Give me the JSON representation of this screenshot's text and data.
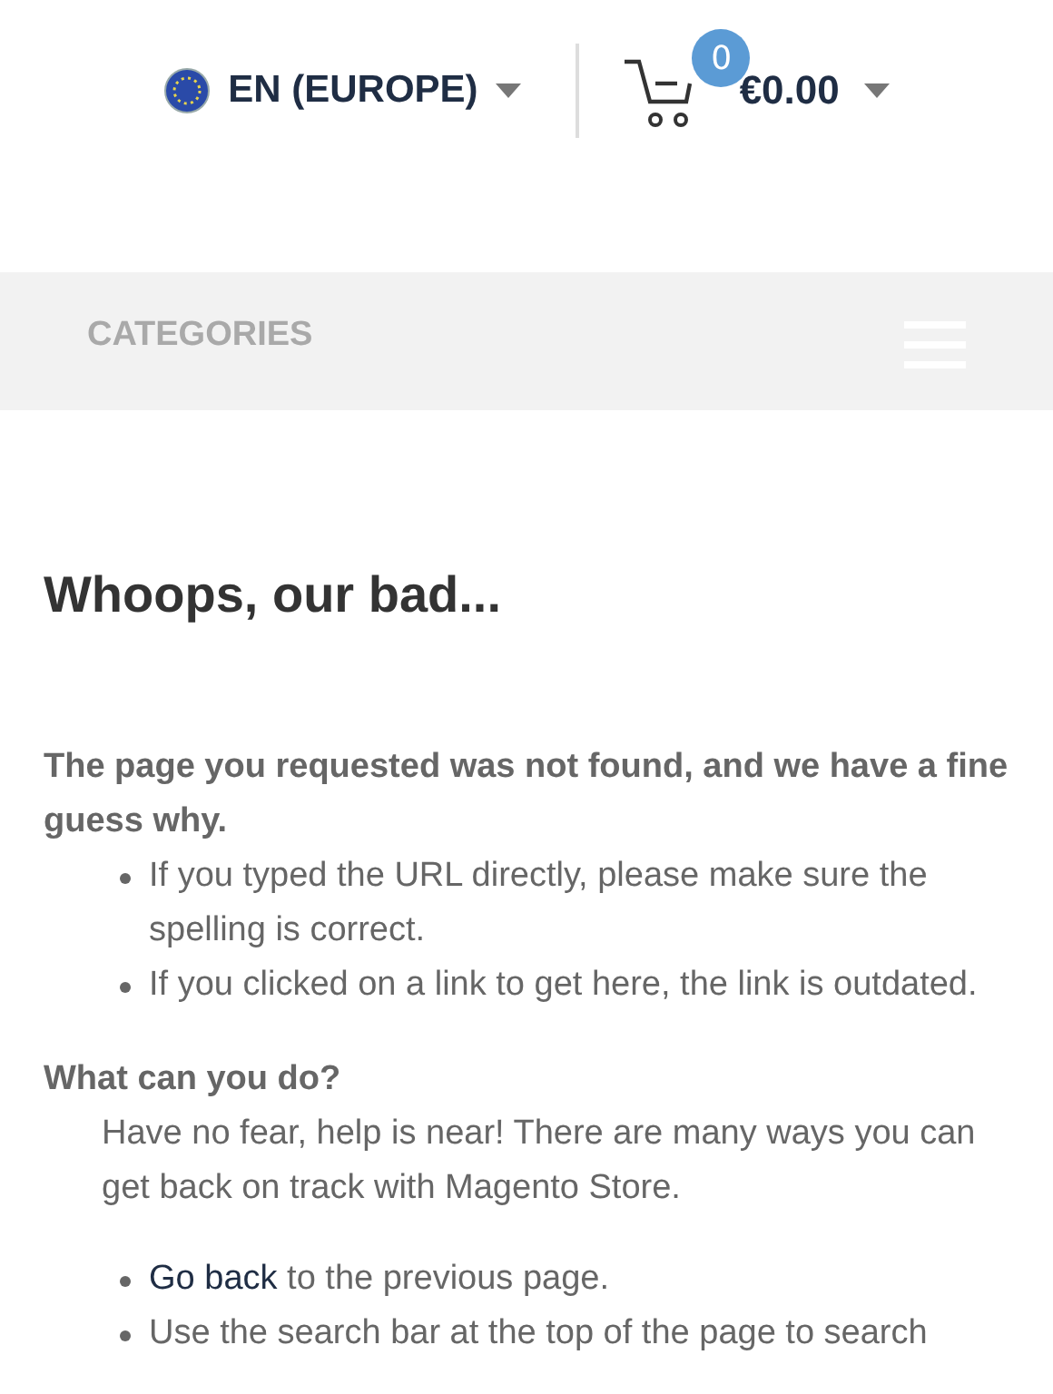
{
  "header": {
    "language": "EN (EUROPE)",
    "cart_count": "0",
    "cart_total": "€0.00"
  },
  "nav": {
    "label": "CATEGORIES"
  },
  "title": "Whoops, our bad...",
  "intro": "The page you requested was not found, and we have a fine guess why.",
  "reasons": [
    "If you typed the URL directly, please make sure the spelling is correct.",
    "If you clicked on a link to get here, the link is outdated."
  ],
  "help_heading": "What can you do?",
  "help_text": "Have no fear, help is near! There are many ways you can get back on track with Magento Store.",
  "actions": [
    {
      "link": "Go back",
      "text": " to the previous page."
    },
    {
      "text": "Use the search bar at the top of the page to search"
    }
  ]
}
